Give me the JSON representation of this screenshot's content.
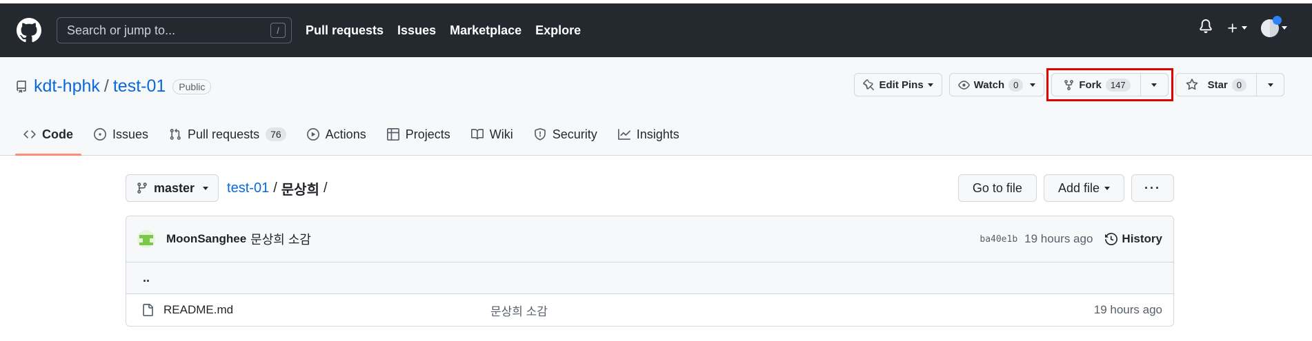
{
  "header": {
    "search_placeholder": "Search or jump to...",
    "search_shortcut": "/",
    "nav": [
      {
        "label": "Pull requests"
      },
      {
        "label": "Issues"
      },
      {
        "label": "Marketplace"
      },
      {
        "label": "Explore"
      }
    ]
  },
  "repo": {
    "owner": "kdt-hphk",
    "separator": "/",
    "name": "test-01",
    "visibility": "Public",
    "actions": {
      "edit_pins": "Edit Pins",
      "watch": "Watch",
      "watch_count": "0",
      "fork": "Fork",
      "fork_count": "147",
      "star": "Star",
      "star_count": "0"
    },
    "tabs": [
      {
        "label": "Code",
        "icon": "code-icon"
      },
      {
        "label": "Issues",
        "icon": "issue-opened-icon"
      },
      {
        "label": "Pull requests",
        "icon": "git-pull-request-icon",
        "count": "76"
      },
      {
        "label": "Actions",
        "icon": "play-icon"
      },
      {
        "label": "Projects",
        "icon": "table-icon"
      },
      {
        "label": "Wiki",
        "icon": "book-icon"
      },
      {
        "label": "Security",
        "icon": "shield-icon"
      },
      {
        "label": "Insights",
        "icon": "graph-icon"
      }
    ]
  },
  "content": {
    "branch": "master",
    "breadcrumb_root": "test-01",
    "breadcrumb_sep": "/",
    "breadcrumb_current": "문상희",
    "breadcrumb_trailing": "/",
    "go_to_file": "Go to file",
    "add_file": "Add file",
    "more": "···",
    "commit": {
      "author": "MoonSanghee",
      "message": "문상희 소감",
      "sha": "ba40e1b",
      "age": "19 hours ago",
      "history": "History"
    },
    "up_dir": "..",
    "files": [
      {
        "name": "README.md",
        "message": "문상희 소감",
        "age": "19 hours ago"
      }
    ]
  },
  "colors": {
    "header_bg": "#24292f",
    "link": "#0969da",
    "tab_underline": "#fd8c73",
    "highlight": "#e00000"
  }
}
